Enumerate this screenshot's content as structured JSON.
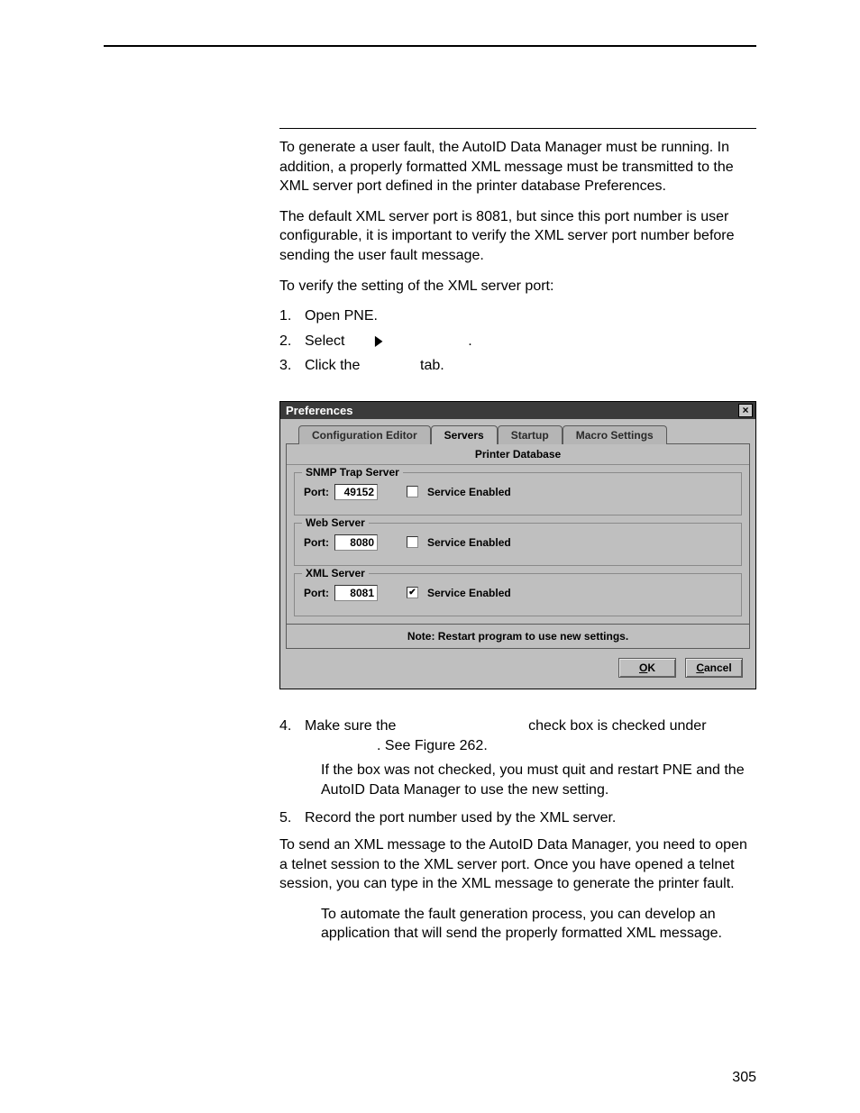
{
  "page_number": "305",
  "body": {
    "p1": "To generate a user fault, the AutoID Data Manager must be running. In addition, a properly formatted XML message must be transmitted to the XML server port defined in the printer database Preferences.",
    "p2": "The default XML server port is 8081, but since this port number is user configurable, it is important to verify the XML server port number before sending the user fault message.",
    "p3": "To verify the setting of the XML server port:",
    "li1": "Open PNE.",
    "li2a": "Select ",
    "li2b": " .",
    "li3a": "Click the ",
    "li3b": " tab.",
    "li4a": "Make sure the ",
    "li4b": " check box is checked under ",
    "li4c": ". See Figure 262.",
    "li4d": "If the box was not checked, you must quit and restart PNE and the AutoID Data Manager to use the new setting.",
    "li5": "Record the port number used by the XML server.",
    "p4": "To send an XML message to the AutoID Data Manager, you need to open a telnet session to the XML server port. Once you have opened a telnet session, you can type in the XML message to generate the printer fault.",
    "note": "To automate the fault generation process, you can develop an application that will send the properly formatted XML message."
  },
  "dialog": {
    "title": "Preferences",
    "tabs": {
      "t1": "Configuration Editor",
      "t2": "Servers",
      "t3": "Startup",
      "t4": "Macro Settings"
    },
    "subhead": "Printer Database",
    "groups": {
      "snmp": {
        "title": "SNMP Trap Server",
        "port_label": "Port:",
        "port_value": "49152",
        "service_label": "Service Enabled",
        "checked": false
      },
      "web": {
        "title": "Web Server",
        "port_label": "Port:",
        "port_value": "8080",
        "service_label": "Service Enabled",
        "checked": false
      },
      "xml": {
        "title": "XML Server",
        "port_label": "Port:",
        "port_value": "8081",
        "service_label": "Service Enabled",
        "checked": true
      }
    },
    "note": "Note: Restart program to use new settings.",
    "ok": "OK",
    "cancel": "Cancel"
  }
}
